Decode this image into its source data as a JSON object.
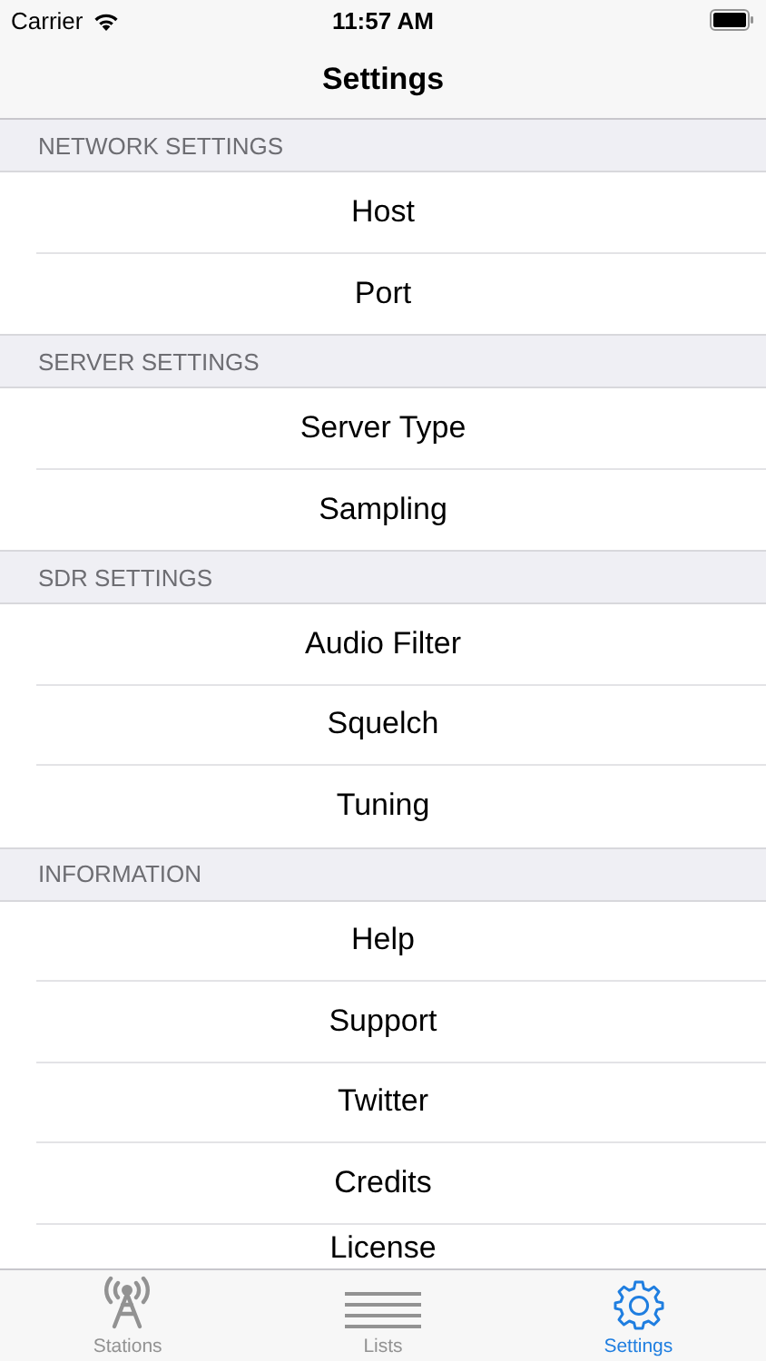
{
  "status_bar": {
    "carrier": "Carrier",
    "time": "11:57 AM"
  },
  "nav_bar": {
    "title": "Settings"
  },
  "sections": [
    {
      "header": "NETWORK SETTINGS",
      "rows": [
        "Host",
        "Port"
      ]
    },
    {
      "header": "SERVER SETTINGS",
      "rows": [
        "Server Type",
        "Sampling"
      ]
    },
    {
      "header": "SDR SETTINGS",
      "rows": [
        "Audio Filter",
        "Squelch",
        "Tuning"
      ]
    },
    {
      "header": "INFORMATION",
      "rows": [
        "Help",
        "Support",
        "Twitter",
        "Credits",
        "License"
      ]
    }
  ],
  "tabs": [
    {
      "label": "Stations",
      "kind": "tower",
      "selected": false
    },
    {
      "label": "Lists",
      "kind": "lines",
      "selected": false
    },
    {
      "label": "Settings",
      "kind": "gear",
      "selected": true
    }
  ]
}
